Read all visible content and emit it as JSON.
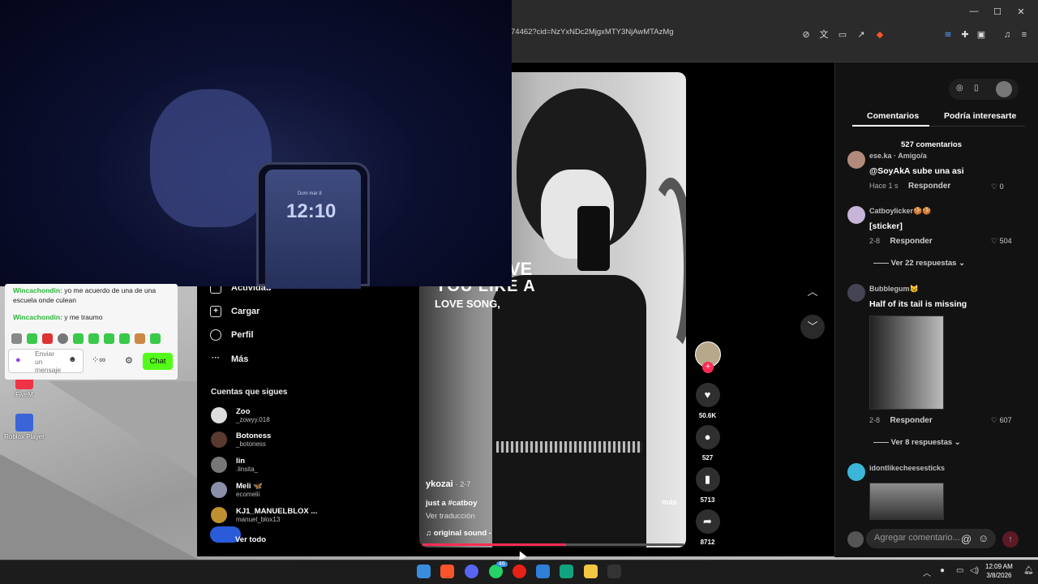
{
  "browser": {
    "url": "74462?cid=NzYxNDc2MjgxMTY3NjAwMTAzMg"
  },
  "tiktok_sidebar": {
    "nav": [
      {
        "label": "Actividad",
        "icon": "bell-icon"
      },
      {
        "label": "Cargar",
        "icon": "plus-square-icon"
      },
      {
        "label": "Perfil",
        "icon": "profile-icon"
      },
      {
        "label": "Más",
        "icon": "more-icon"
      }
    ],
    "follows_title": "Cuentas que sigues",
    "follows": [
      {
        "name": "Zoo",
        "handle": "_zowyy.018"
      },
      {
        "name": "Botoness",
        "handle": "_botoness"
      },
      {
        "name": "lin",
        "handle": ".linsita_"
      },
      {
        "name": "Meli 🦋",
        "handle": "ecomelii"
      },
      {
        "name": "KJ1_MANUELBLOX ...",
        "handle": "manuel_blox13"
      }
    ],
    "see_all": "Ver todo"
  },
  "video": {
    "overlay_line1": "VE",
    "overlay_line2": "YOU LIKE A",
    "overlay_line3": "LOVE SONG,",
    "username": "ykozai",
    "date": "· 2-7",
    "description": "just a #catboy",
    "translate": "Ver traducción",
    "sound": "♫  original sound -",
    "more": "más",
    "progress": 0.55
  },
  "actions": {
    "likes": "50.6K",
    "comments": "527",
    "saves": "5713",
    "shares": "8712"
  },
  "comments_panel": {
    "tabs": [
      "Comentarios",
      "Podría interesarte"
    ],
    "count": "527 comentarios",
    "comments": [
      {
        "user": "ese.ka · Amigo/a",
        "text": "@SoyAkA sube una asi",
        "time": "Hace 1 s",
        "reply": "Responder",
        "likes": "0"
      },
      {
        "user": "Catboylicker🍪🍪",
        "text": "[sticker]",
        "time": "2-8",
        "reply": "Responder",
        "likes": "504",
        "view_replies": "Ver 22 respuestas"
      },
      {
        "user": "Bubblegum😼",
        "text": "Half of its tail is missing",
        "time": "2-8",
        "reply": "Responder",
        "likes": "607",
        "view_replies": "Ver 8 respuestas"
      },
      {
        "user": "idontlikecheesesticks",
        "text": ""
      }
    ],
    "add_placeholder": "Agregar comentario..."
  },
  "webcam": {
    "phone_date": "Dom mar 8",
    "phone_time": "12:10"
  },
  "chat": {
    "messages": [
      {
        "user": "Wincachondin:",
        "text": " yo me acuerdo de una de una escuela onde culean"
      },
      {
        "user": "Wincachondin:",
        "text": " y me traumo"
      }
    ],
    "input_placeholder": "Enviar un mensaje",
    "send_label": "Chat"
  },
  "desktop_icons": [
    "FiveM",
    "Roblox Player"
  ],
  "taskbar": {
    "time": "12:09 AM",
    "date": "3/8/2026",
    "badge": "46"
  }
}
